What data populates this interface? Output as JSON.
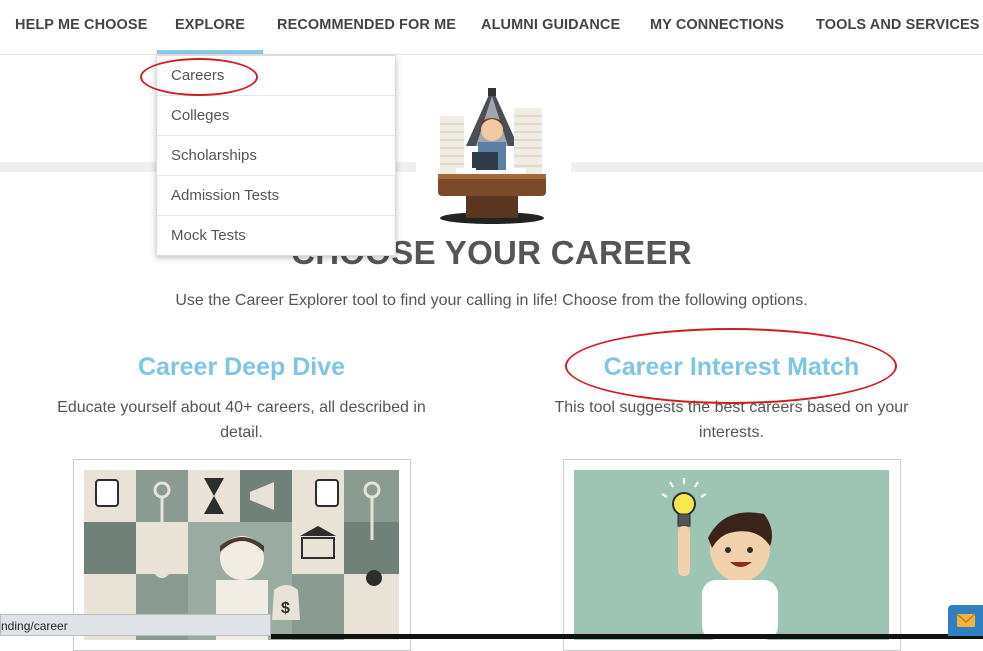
{
  "nav": {
    "items": [
      {
        "label": "HELP ME CHOOSE"
      },
      {
        "label": "EXPLORE"
      },
      {
        "label": "RECOMMENDED FOR ME"
      },
      {
        "label": "ALUMNI GUIDANCE"
      },
      {
        "label": "MY CONNECTIONS"
      },
      {
        "label": "TOOLS AND SERVICES"
      }
    ],
    "active_index": 1
  },
  "dropdown": {
    "items": [
      {
        "label": "Careers"
      },
      {
        "label": "Colleges"
      },
      {
        "label": "Scholarships"
      },
      {
        "label": "Admission Tests"
      },
      {
        "label": "Mock Tests"
      }
    ],
    "highlighted": "Careers"
  },
  "hero": {
    "title": "CHOOSE YOUR CAREER",
    "subtitle": "Use the Career Explorer tool to find your calling in life! Choose from the following options."
  },
  "cards": [
    {
      "title": "Career Deep Dive",
      "desc_line1": "Educate yourself about 40+ careers, all described in",
      "desc_line2": "detail."
    },
    {
      "title": "Career Interest Match",
      "desc_line1": "This tool suggests the best careers based on your",
      "desc_line2": "interests."
    }
  ],
  "status": {
    "url": "nding/career"
  },
  "colors": {
    "accent": "#7fc5e4",
    "annotation": "#d01c24",
    "card_bg": "#9ec4b4"
  }
}
